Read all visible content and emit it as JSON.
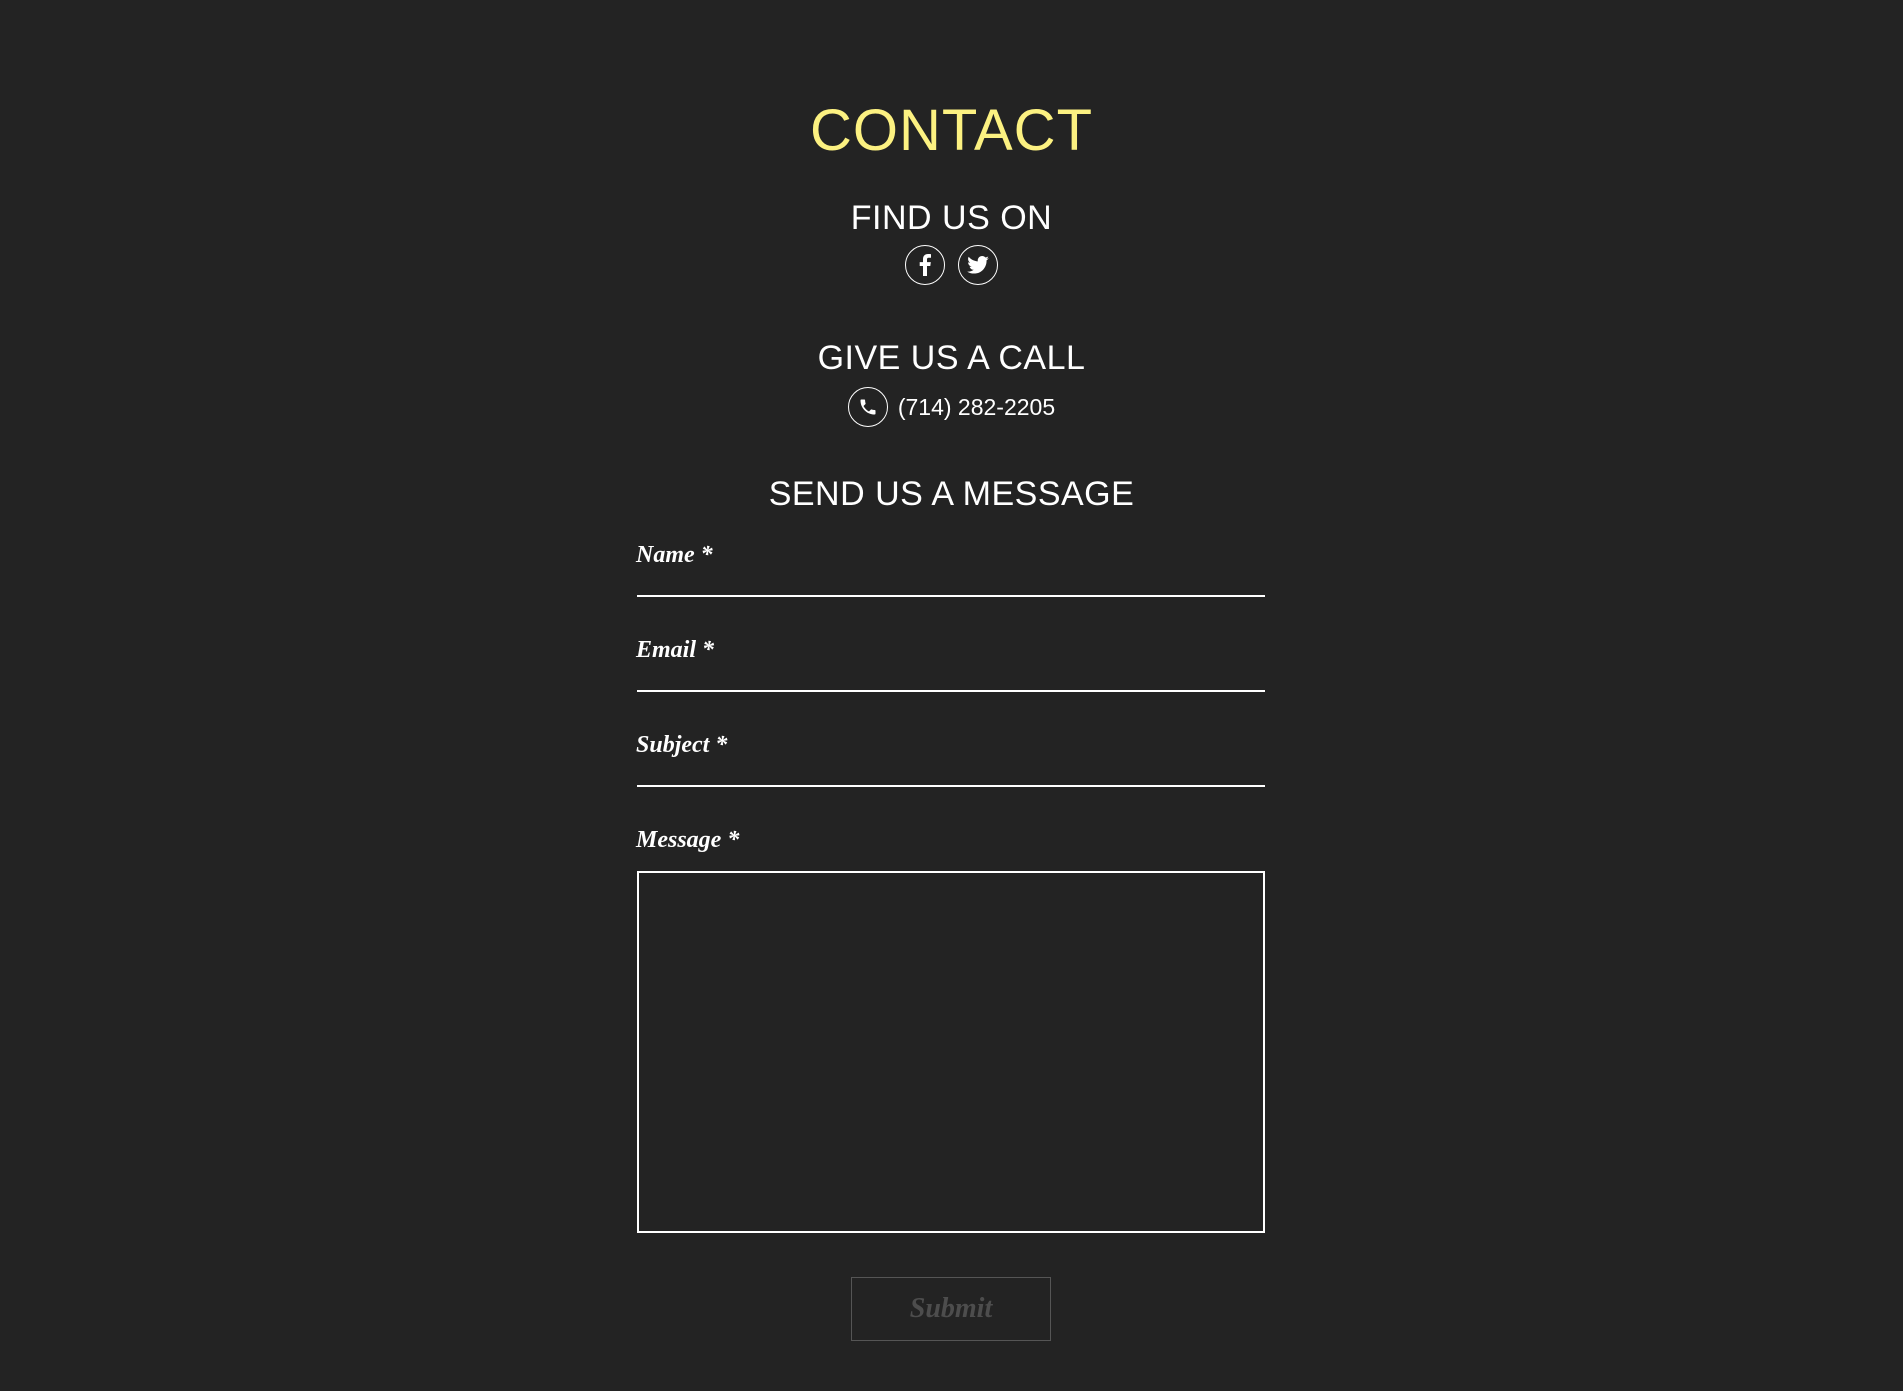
{
  "page": {
    "title": "CONTACT"
  },
  "social": {
    "heading": "FIND US ON",
    "icons": [
      "facebook-icon",
      "twitter-icon"
    ]
  },
  "call": {
    "heading": "GIVE US A CALL",
    "phone": "(714) 282-2205",
    "icon": "phone-icon"
  },
  "message_form": {
    "heading": "SEND US A MESSAGE",
    "name_label": "Name *",
    "email_label": "Email *",
    "subject_label": "Subject *",
    "message_label": "Message *",
    "name_value": "",
    "email_value": "",
    "subject_value": "",
    "message_value": "",
    "submit_label": "Submit"
  },
  "colors": {
    "background": "#232323",
    "title": "#fcf181",
    "text": "#ffffff",
    "submit_disabled": "#4d4d4d"
  }
}
